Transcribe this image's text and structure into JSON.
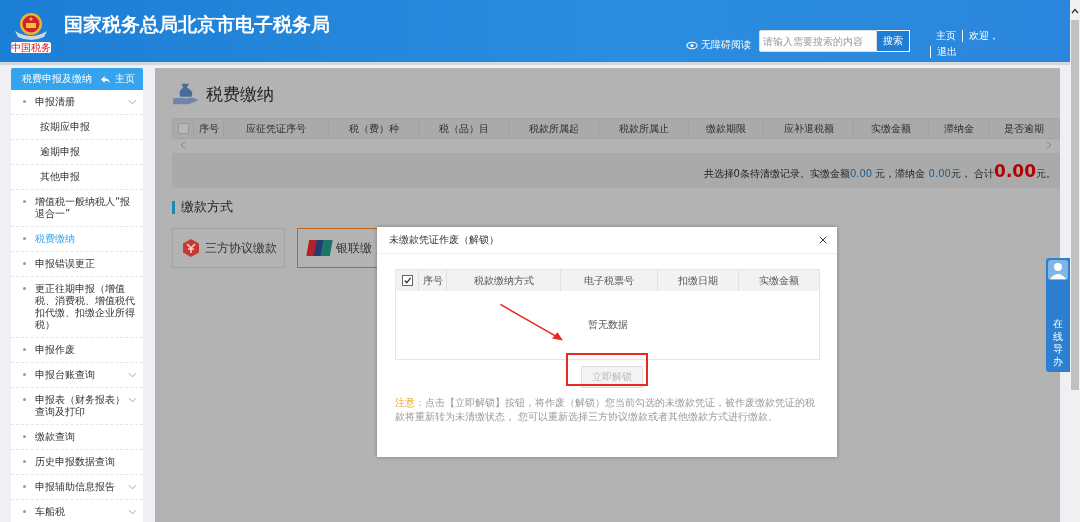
{
  "header": {
    "logo_caption": "中国税务",
    "title": "国家税务总局北京市电子税务局",
    "accessibility": "无障碍阅读",
    "search": {
      "placeholder": "请输入需要搜索的内容",
      "button": "搜索"
    },
    "nav": [
      "主页",
      "欢迎，",
      "退出"
    ]
  },
  "sidebar": {
    "title": "税费申报及缴纳",
    "home": "主页",
    "items": [
      {
        "label": "申报清册",
        "expandable": true,
        "selected": false,
        "children": [
          {
            "label": "按期应申报",
            "selected": false
          },
          {
            "label": "逾期申报",
            "selected": false
          },
          {
            "label": "其他申报",
            "selected": false
          }
        ]
      },
      {
        "label": "增值税一般纳税人“报退合一”",
        "expandable": false,
        "selected": false
      },
      {
        "label": "税费缴纳",
        "expandable": false,
        "selected": true
      },
      {
        "label": "申报错误更正",
        "expandable": false,
        "selected": false
      },
      {
        "label": "更正往期申报（增值税、消费税、增值税代扣代缴、扣缴企业所得税）",
        "expandable": false,
        "selected": false
      },
      {
        "label": "申报作废",
        "expandable": false,
        "selected": false
      },
      {
        "label": "申报台账查询",
        "expandable": true,
        "selected": false
      },
      {
        "label": "申报表（财务报表）查询及打印",
        "expandable": true,
        "selected": false
      },
      {
        "label": "缴款查询",
        "expandable": false,
        "selected": false
      },
      {
        "label": "历史申报数据查询",
        "expandable": false,
        "selected": false
      },
      {
        "label": "申报辅助信息报告",
        "expandable": true,
        "selected": false
      },
      {
        "label": "车船税",
        "expandable": true,
        "selected": false
      }
    ]
  },
  "page": {
    "title": "税费缴纳",
    "table": {
      "select_all_checked": false,
      "columns": [
        "序号",
        "应征凭证序号",
        "税（费）种",
        "税（品）目",
        "税款所属起",
        "税款所属止",
        "缴款期限",
        "应补退税额",
        "实缴金额",
        "滞纳金",
        "是否逾期"
      ]
    },
    "summary": [
      {
        "kind": "text",
        "text": "共选择0条待清缴记录。实缴金额"
      },
      {
        "kind": "amount",
        "text": "0.00"
      },
      {
        "kind": "text",
        "text": " 元，滞纳金 "
      },
      {
        "kind": "amount",
        "text": "0.00"
      },
      {
        "kind": "text",
        "text": "元， 合计"
      },
      {
        "kind": "total",
        "text": "0.00"
      },
      {
        "kind": "text",
        "text": "元。"
      }
    ],
    "section_title": "缴款方式",
    "payment_methods": [
      {
        "label": "三方协议缴款",
        "kind": "agreement",
        "selected": false
      },
      {
        "label": "银联缴",
        "kind": "unionpay",
        "selected": true
      }
    ]
  },
  "dialog": {
    "title": "未缴款凭证作废（解锁）",
    "table": {
      "select_all_checked": true,
      "columns": [
        "序号",
        "税款缴纳方式",
        "电子税票号",
        "扣缴日期",
        "实缴金额"
      ],
      "empty_text": "暂无数据"
    },
    "button": {
      "label": "立即解锁",
      "disabled": true
    },
    "note": {
      "label": "注意：",
      "text": "点击【立即解锁】按钮，将作废（解锁）您当前勾选的未缴款凭证，被作废缴款凭证的税款将重新转为未清缴状态， 您可以重新选择三方协议缴款或者其他缴款方式进行缴款。"
    }
  },
  "help_widget": {
    "label": "在线导办"
  }
}
